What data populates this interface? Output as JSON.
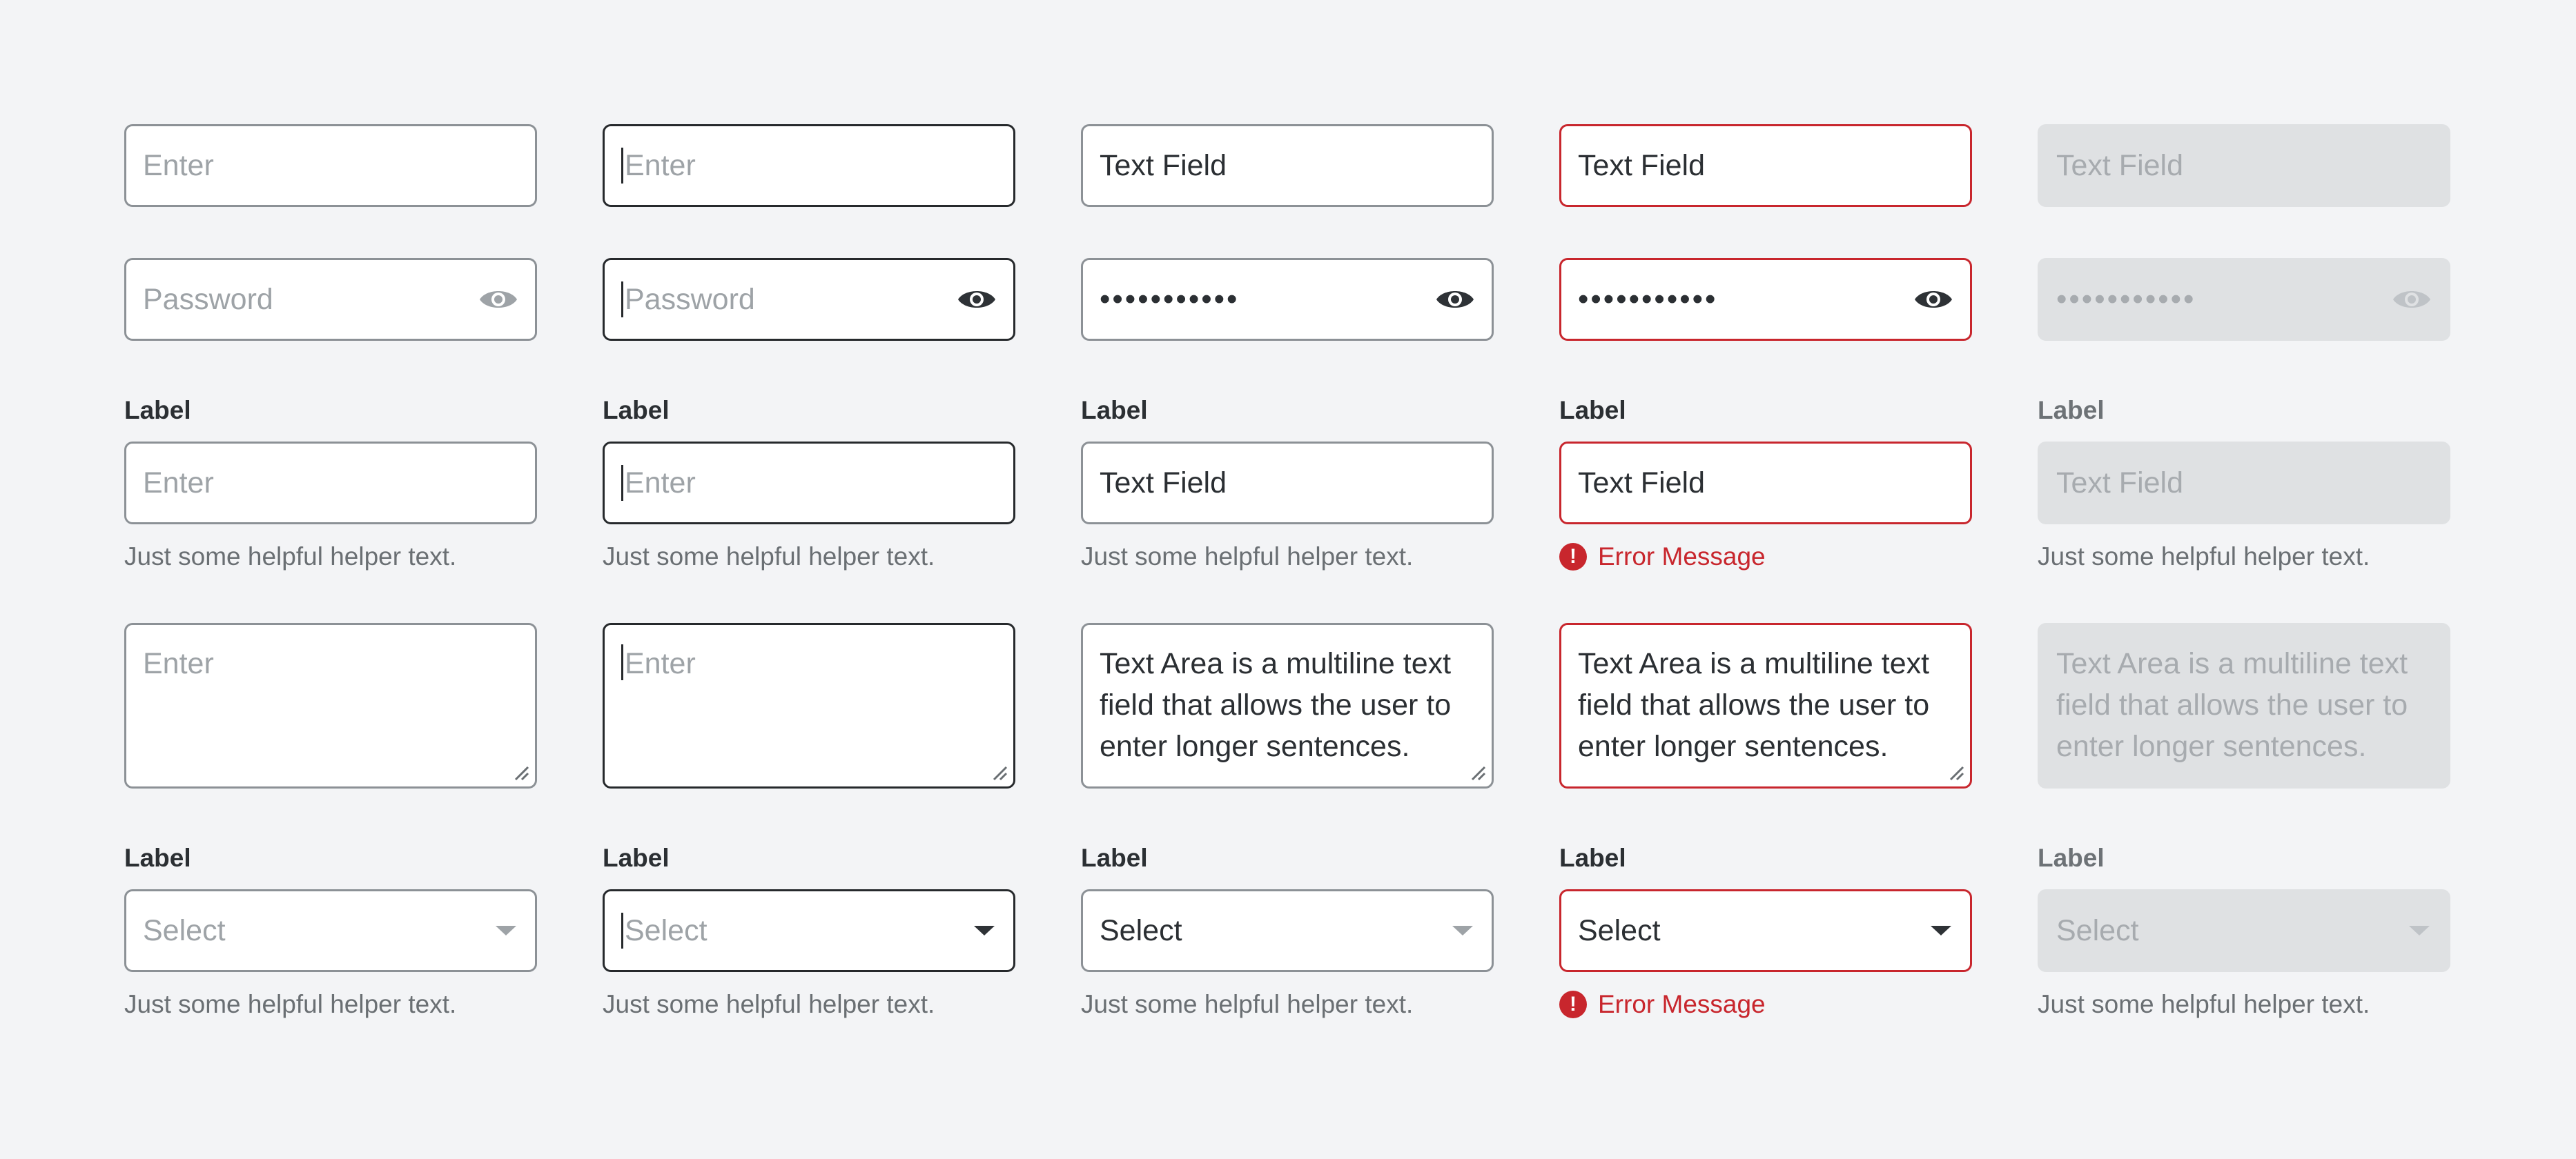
{
  "columns": [
    {
      "state": "default",
      "input_text": "Enter",
      "password_text": "Password",
      "label": "Label",
      "labeled_input_text": "Enter",
      "helper": "Just some helpful helper text.",
      "area_text": "Enter",
      "label2": "Label",
      "select_text": "Select",
      "helper2": "Just some helpful helper text."
    },
    {
      "state": "focused",
      "input_text": "Enter",
      "password_text": "Password",
      "label": "Label",
      "labeled_input_text": "Enter",
      "helper": "Just some helpful helper text.",
      "area_text": "Enter",
      "label2": "Label",
      "select_text": "Select",
      "helper2": "Just some helpful helper text."
    },
    {
      "state": "filled",
      "input_text": "Text Field",
      "password_text": "•••••••••••",
      "label": "Label",
      "labeled_input_text": "Text Field",
      "helper": "Just some helpful helper text.",
      "area_text": "Text Area is a multiline text field that allows the user to enter longer sentences.",
      "label2": "Label",
      "select_text": "Select",
      "helper2": "Just some helpful helper text."
    },
    {
      "state": "error",
      "input_text": "Text Field",
      "password_text": "•••••••••••",
      "label": "Label",
      "labeled_input_text": "Text Field",
      "helper": "Error Message",
      "area_text": "Text Area is a multiline text field that allows the user to enter longer sentences.",
      "label2": "Label",
      "select_text": "Select",
      "helper2": "Error Message"
    },
    {
      "state": "disabled",
      "input_text": "Text Field",
      "password_text": "•••••••••••",
      "label": "Label",
      "labeled_input_text": "Text Field",
      "helper": "Just some helpful helper text.",
      "area_text": "Text Area is a multiline text field that allows the user to enter longer sentences.",
      "label2": "Label",
      "select_text": "Select",
      "helper2": "Just some helpful helper text."
    }
  ],
  "icons": {
    "password_toggle": "eye-icon",
    "select_arrow": "chevron-down-icon",
    "error": "error-icon",
    "resize": "resize-handle-icon"
  },
  "colors": {
    "background": "#f3f4f6",
    "border_default": "#8c9196",
    "border_focused": "#26292c",
    "error": "#c8262d",
    "disabled_fill": "#dfe1e3"
  }
}
